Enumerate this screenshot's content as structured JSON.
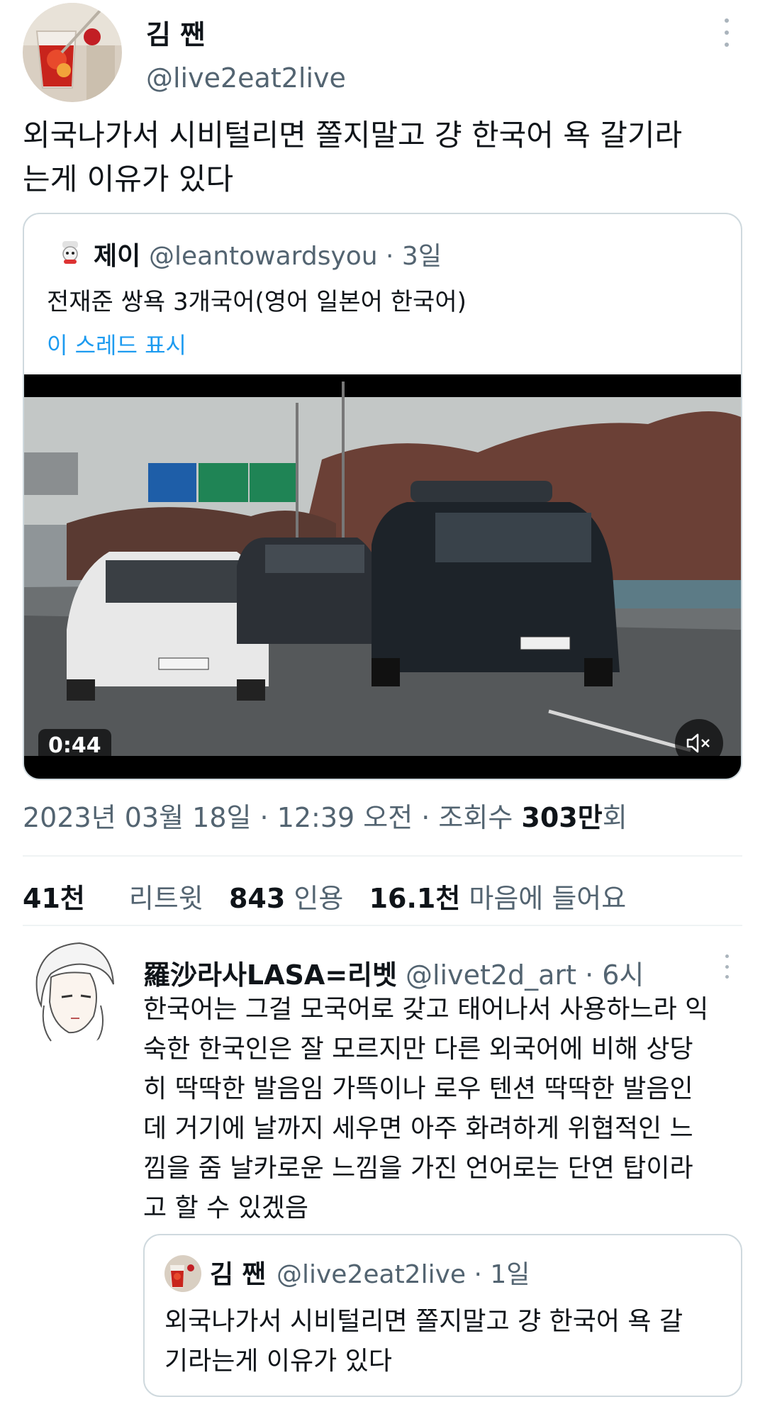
{
  "tweet": {
    "display_name": "김 짼",
    "handle": "@live2eat2live",
    "text_line1": "외국나가서 시비털리면 쫄지말고 걍 한국어 욕 갈기라",
    "text_line2": "는게 이유가 있다"
  },
  "quote": {
    "name": "제이",
    "handle_time": "@leantowardsyou · 3일",
    "text": "전재준 쌍욕 3개국어(영어 일본어 한국어)",
    "show_thread": "이 스레드 표시",
    "video_duration": "0:44",
    "mute_icon": "volume-mute-icon"
  },
  "meta": {
    "date_time": "2023년 03월 18일 · 12:39 오전 · 조회수 ",
    "views_number": "303만",
    "views_suffix": "회"
  },
  "stats": {
    "retweets_count": "41천",
    "retweets_label": "리트윗",
    "quotes_count": "843",
    "quotes_label": "인용",
    "likes_count": "16.1천",
    "likes_label": "마음에 들어요"
  },
  "reply": {
    "name": "羅沙라사LASA=리벳",
    "handle_time": "@livet2d_art · 6시",
    "lines": [
      "한국어는 그걸 모국어로 갖고 태어나서 사용하느라 익",
      "숙한 한국인은 잘 모르지만 다른 외국어에 비해 상당",
      "히 딱딱한 발음임 가뜩이나 로우 텐션 딱딱한 발음인",
      "데 거기에 날까지 세우면 아주 화려하게 위협적인 느",
      "낌을 줌 날카로운 느낌을 가진 언어로는 단연 탑이라",
      "고 할 수 있겠음"
    ],
    "quoted": {
      "name": "김 짼",
      "handle_time": "@live2eat2live · 1일",
      "line1": "외국나가서 시비털리면 쫄지말고 걍 한국어 욕 갈",
      "line2": "기라는게 이유가 있다"
    }
  },
  "colors": {
    "text": "#0f1419",
    "secondary": "#536471",
    "link": "#1d9bf0",
    "border": "#cfd9de"
  }
}
